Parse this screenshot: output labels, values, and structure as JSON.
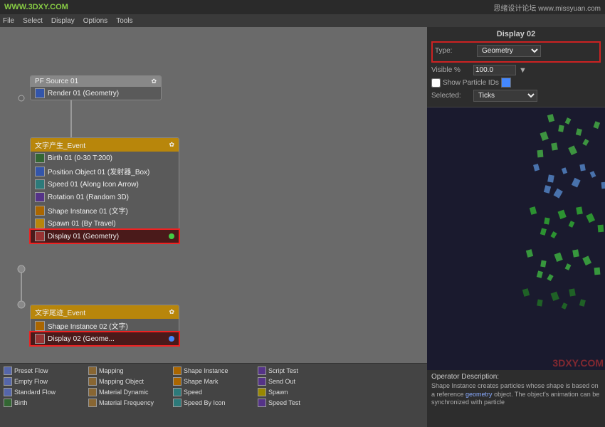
{
  "topbar": {
    "left": "WWW.3DXY.COM",
    "right": "思绪设计论坛  www.missyuan.com"
  },
  "menubar": {
    "items": [
      "File",
      "Select",
      "Display",
      "Options",
      "Tools"
    ]
  },
  "nodes": {
    "pf_source": {
      "title": "PF Source 01",
      "rows": [
        "Render 01 (Geometry)"
      ]
    },
    "event1": {
      "title": "文字产生_Event",
      "rows": [
        "Birth 01 (0-30 T:200)",
        "Position Object 01 (发射器_Box)",
        "Speed 01 (Along Icon Arrow)",
        "Rotation 01 (Random 3D)",
        "Shape Instance 01 (文字)",
        "Spawn 01 (By Travel)",
        "Display 01 (Geometry)"
      ]
    },
    "event2": {
      "title": "文字尾迹_Event",
      "rows": [
        "Shape Instance 02 (文字)",
        "Display 02 (Geome..."
      ]
    }
  },
  "display_props": {
    "title": "Display 02",
    "type_label": "Type:",
    "type_value": "Geometry",
    "visible_label": "Visible %",
    "visible_value": "100.0",
    "show_particle_ids": "Show Particle IDs",
    "selected_label": "Selected:",
    "selected_value": "Ticks",
    "color_swatch": "#4488ff"
  },
  "op_description": {
    "title": "Operator Description:",
    "text": "Shape Instance creates particles whose shape is based on a reference geometry object. The object's animation can be synchronized with particle"
  },
  "bottom_tools": [
    [
      "Preset Flow",
      "Mapping",
      "Shape Instance",
      "Script Test"
    ],
    [
      "Empty Flow",
      "Mapping Object",
      "Shape Mark",
      "Send Out"
    ],
    [
      "Standard Flow",
      "Material Dynamic",
      "Speed",
      "Spawn"
    ],
    [
      "Birth",
      "Material Frequency",
      "Speed By Icon",
      ""
    ],
    [
      "",
      "",
      "",
      "Speed Test"
    ]
  ],
  "bottom_tools_flat": [
    {
      "label": "Preset Flow",
      "col": 1
    },
    {
      "label": "Empty Flow",
      "col": 1
    },
    {
      "label": "Standard Flow",
      "col": 1
    },
    {
      "label": "Birth",
      "col": 1
    },
    {
      "label": "Mapping",
      "col": 2
    },
    {
      "label": "Mapping Object",
      "col": 2
    },
    {
      "label": "Material Dynamic",
      "col": 2
    },
    {
      "label": "Material Frequency",
      "col": 2
    },
    {
      "label": "Shape Instance",
      "col": 3
    },
    {
      "label": "Shape Mark",
      "col": 3
    },
    {
      "label": "Speed",
      "col": 3
    },
    {
      "label": "Speed By Icon",
      "col": 3
    },
    {
      "label": "Script Test",
      "col": 4
    },
    {
      "label": "Send Out",
      "col": 4
    },
    {
      "label": "Spawn",
      "col": 4
    },
    {
      "label": "Speed Test",
      "col": 4
    }
  ]
}
